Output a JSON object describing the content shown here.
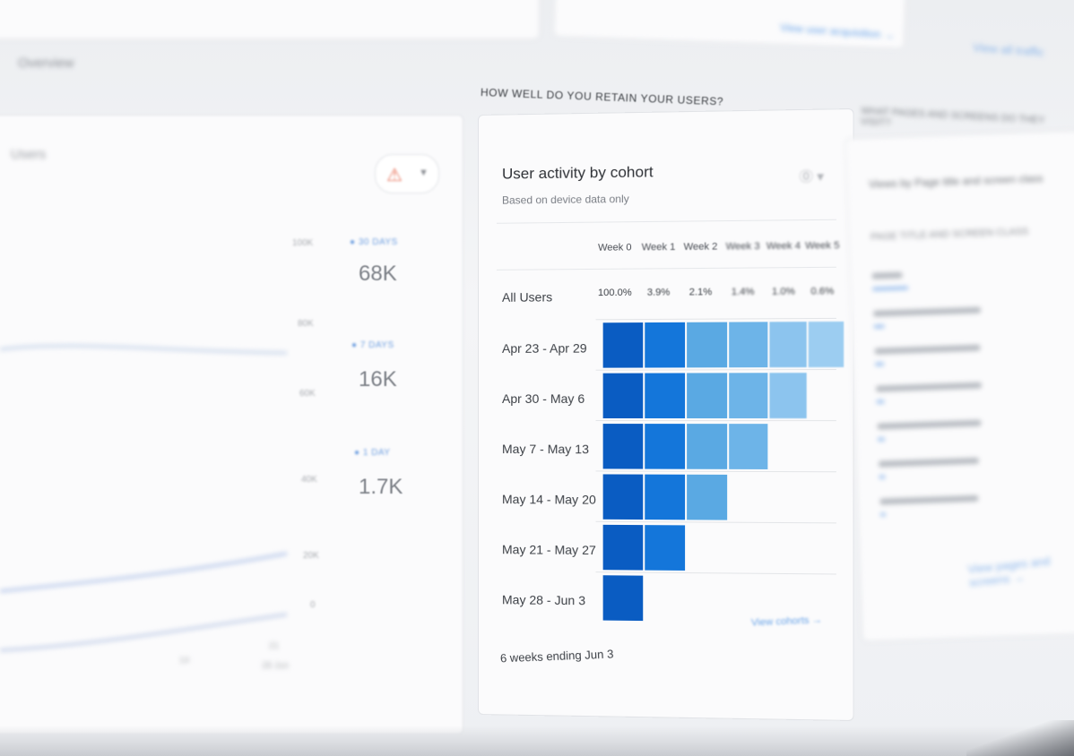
{
  "top": {
    "link_mid": "View user acquisition →",
    "link_right": "View all traffic",
    "left_label": "Overview"
  },
  "left_panel": {
    "title": "Users",
    "alert_icon": "warning-icon",
    "y_ticks": [
      "100K",
      "80K",
      "60K",
      "40K",
      "20K",
      "0"
    ],
    "legend": [
      {
        "key": "● 30 DAYS",
        "value": "68K"
      },
      {
        "key": "● 7 DAYS",
        "value": "16K"
      },
      {
        "key": "● 1 DAY",
        "value": "1.7K"
      }
    ],
    "x_ticks": [
      "14",
      "21",
      "28 Jun"
    ]
  },
  "cohort": {
    "section_heading": "HOW WELL DO YOU RETAIN YOUR USERS?",
    "title": "User activity by cohort",
    "subtitle": "Based on device data only",
    "weeks": [
      "Week 0",
      "Week 1",
      "Week 2",
      "Week 3",
      "Week 4",
      "Week 5"
    ],
    "all_users_label": "All Users",
    "all_users_pct": [
      "100.0%",
      "3.9%",
      "2.1%",
      "1.4%",
      "1.0%",
      "0.6%"
    ],
    "rows": [
      {
        "label": "Apr 23 - Apr 29",
        "weeks_filled": 6
      },
      {
        "label": "Apr 30 - May 6",
        "weeks_filled": 5
      },
      {
        "label": "May 7 - May 13",
        "weeks_filled": 4
      },
      {
        "label": "May 14 - May 20",
        "weeks_filled": 3
      },
      {
        "label": "May 21 - May 27",
        "weeks_filled": 2
      },
      {
        "label": "May 28 - Jun 3",
        "weeks_filled": 1
      }
    ],
    "footer": "6 weeks ending Jun 3",
    "link": "View cohorts →",
    "colors": {
      "week0": "#0a5cc2",
      "week1": "#1476da",
      "week2": "#5aa9e3",
      "week3": "#6db4e8",
      "week4": "#8cc4ee",
      "week5": "#9ccdf1"
    }
  },
  "right_panel": {
    "heading": "WHAT PAGES AND SCREENS DO THEY VISIT?",
    "card_title": "Views by Page title and screen class",
    "sub": "PAGE TITLE AND SCREEN CLASS",
    "link": "View pages and screens →"
  }
}
